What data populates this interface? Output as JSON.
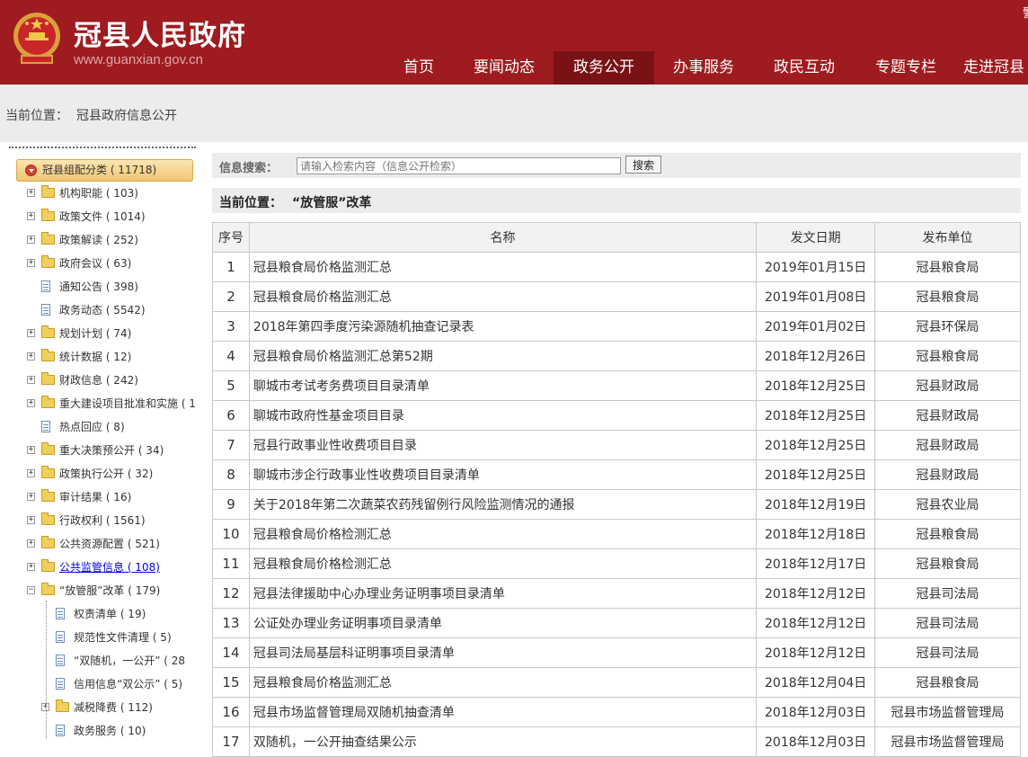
{
  "header": {
    "title": "冠县人民政府",
    "url": "www.guanxian.gov.cn",
    "corner_char": "警"
  },
  "nav": {
    "items": [
      {
        "label": "首页",
        "active": false
      },
      {
        "label": "要闻动态",
        "active": false
      },
      {
        "label": "政务公开",
        "active": true
      },
      {
        "label": "办事服务",
        "active": false
      },
      {
        "label": "政民互动",
        "active": false
      },
      {
        "label": "专题专栏",
        "active": false
      },
      {
        "label": "走进冠县",
        "active": false
      }
    ]
  },
  "breadcrumb": {
    "label": "当前位置：",
    "value": "冠县政府信息公开"
  },
  "sidebar": {
    "root": "冠县组配分类 ( 11718)",
    "items": [
      {
        "label": "机构职能 ( 103)",
        "icon": "folder-icon",
        "expand": "+"
      },
      {
        "label": "政策文件 ( 1014)",
        "icon": "folder-icon",
        "expand": "+"
      },
      {
        "label": "政策解读 ( 252)",
        "icon": "folder-icon",
        "expand": "+"
      },
      {
        "label": "政府会议 ( 63)",
        "icon": "folder-icon",
        "expand": "+"
      },
      {
        "label": "通知公告 ( 398)",
        "icon": "document-icon",
        "expand": ""
      },
      {
        "label": "政务动态 ( 5542)",
        "icon": "document-icon",
        "expand": ""
      },
      {
        "label": "规划计划 ( 74)",
        "icon": "folder-icon",
        "expand": "+"
      },
      {
        "label": "统计数据 ( 12)",
        "icon": "folder-icon",
        "expand": "+"
      },
      {
        "label": "财政信息 ( 242)",
        "icon": "folder-icon",
        "expand": "+"
      },
      {
        "label": "重大建设项目批准和实施 ( 1",
        "icon": "folder-icon",
        "expand": "+"
      },
      {
        "label": "热点回应 ( 8)",
        "icon": "document-icon",
        "expand": ""
      },
      {
        "label": "重大决策预公开 ( 34)",
        "icon": "folder-icon",
        "expand": "+"
      },
      {
        "label": "政策执行公开 ( 32)",
        "icon": "folder-icon",
        "expand": "+"
      },
      {
        "label": "审计结果 ( 16)",
        "icon": "folder-icon",
        "expand": "+"
      },
      {
        "label": "行政权利 ( 1561)",
        "icon": "folder-icon",
        "expand": "+"
      },
      {
        "label": "公共资源配置 ( 521)",
        "icon": "folder-icon",
        "expand": "+"
      },
      {
        "label": "公共监管信息 ( 108)",
        "icon": "folder-icon",
        "expand": "+",
        "link": true
      },
      {
        "label": "“放管服”改革 ( 179)",
        "icon": "folder-icon",
        "expand": "−"
      },
      {
        "label": "权责清单 ( 19)",
        "icon": "document-icon",
        "expand": "",
        "child": true
      },
      {
        "label": "规范性文件清理 ( 5)",
        "icon": "document-icon",
        "expand": "",
        "child": true
      },
      {
        "label": "“双随机，一公开” ( 28",
        "icon": "document-icon",
        "expand": "",
        "child": true
      },
      {
        "label": "信用信息“双公示” ( 5)",
        "icon": "document-icon",
        "expand": "",
        "child": true
      },
      {
        "label": "减税降费 ( 112)",
        "icon": "folder-icon",
        "expand": "+",
        "child": true
      },
      {
        "label": "政务服务 ( 10)",
        "icon": "document-icon",
        "expand": "",
        "child": true
      }
    ]
  },
  "search": {
    "label": "信息搜索：",
    "placeholder": "请输入检索内容（信息公开检索）",
    "button": "搜索"
  },
  "current": {
    "label": "当前位置：",
    "value": "“放管服”改革"
  },
  "table": {
    "headers": [
      "序号",
      "名称",
      "发文日期",
      "发布单位"
    ],
    "rows": [
      {
        "no": "1",
        "name": "冠县粮食局价格监测汇总",
        "date": "2019年01月15日",
        "unit": "冠县粮食局"
      },
      {
        "no": "2",
        "name": "冠县粮食局价格监测汇总",
        "date": "2019年01月08日",
        "unit": "冠县粮食局"
      },
      {
        "no": "3",
        "name": "2018年第四季度污染源随机抽查记录表",
        "date": "2019年01月02日",
        "unit": "冠县环保局"
      },
      {
        "no": "4",
        "name": "冠县粮食局价格监测汇总第52期",
        "date": "2018年12月26日",
        "unit": "冠县粮食局"
      },
      {
        "no": "5",
        "name": "聊城市考试考务费项目目录清单",
        "date": "2018年12月25日",
        "unit": "冠县财政局"
      },
      {
        "no": "6",
        "name": "聊城市政府性基金项目目录",
        "date": "2018年12月25日",
        "unit": "冠县财政局"
      },
      {
        "no": "7",
        "name": "冠县行政事业性收费项目目录",
        "date": "2018年12月25日",
        "unit": "冠县财政局"
      },
      {
        "no": "8",
        "name": "聊城市涉企行政事业性收费项目目录清单",
        "date": "2018年12月25日",
        "unit": "冠县财政局"
      },
      {
        "no": "9",
        "name": "关于2018年第二次蔬菜农药残留例行风险监测情况的通报",
        "date": "2018年12月19日",
        "unit": "冠县农业局"
      },
      {
        "no": "10",
        "name": "冠县粮食局价格检测汇总",
        "date": "2018年12月18日",
        "unit": "冠县粮食局"
      },
      {
        "no": "11",
        "name": "冠县粮食局价格检测汇总",
        "date": "2018年12月17日",
        "unit": "冠县粮食局"
      },
      {
        "no": "12",
        "name": "冠县法律援助中心办理业务证明事项目录清单",
        "date": "2018年12月12日",
        "unit": "冠县司法局"
      },
      {
        "no": "13",
        "name": "公证处办理业务证明事项目录清单",
        "date": "2018年12月12日",
        "unit": "冠县司法局"
      },
      {
        "no": "14",
        "name": "冠县司法局基层科证明事项目录清单",
        "date": "2018年12月12日",
        "unit": "冠县司法局"
      },
      {
        "no": "15",
        "name": "冠县粮食局价格监测汇总",
        "date": "2018年12月04日",
        "unit": "冠县粮食局"
      },
      {
        "no": "16",
        "name": "冠县市场监督管理局双随机抽查清单",
        "date": "2018年12月03日",
        "unit": "冠县市场监督管理局"
      },
      {
        "no": "17",
        "name": "双随机，一公开抽查结果公示",
        "date": "2018年12月03日",
        "unit": "冠县市场监督管理局"
      }
    ]
  }
}
